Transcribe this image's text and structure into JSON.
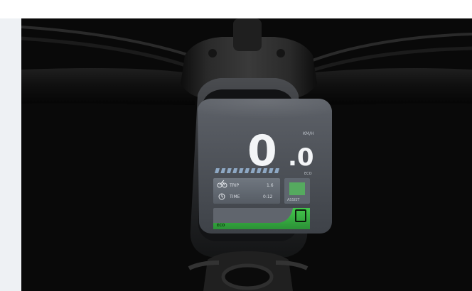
{
  "display": {
    "unit_top": "KM/H",
    "speed_integer": "0",
    "speed_decimal": ".0",
    "battery_label": "ECO",
    "trip_label": "TRIP",
    "trip_value": "1.6",
    "time_label": "TIME",
    "time_value": "0:12",
    "mode_label": "ASSIST",
    "bottom_left_label": "ECO",
    "battery_segments_filled": 11,
    "battery_segments_total": 11
  },
  "icons": {
    "trip_icon": "bicycle-icon",
    "time_icon": "clock-icon",
    "assist_icon": "assist-box-icon"
  },
  "colors": {
    "accent_green": "#3fb54a",
    "screen_bg": "#4a4d54",
    "panel_bg": "#62666d"
  }
}
